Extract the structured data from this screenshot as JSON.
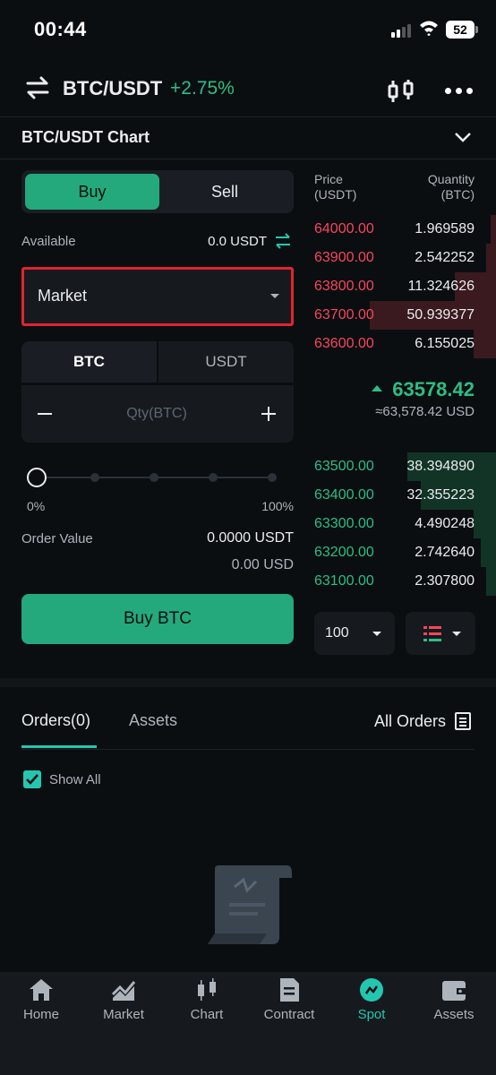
{
  "status_bar": {
    "time": "00:44",
    "battery": "52"
  },
  "header": {
    "pair": "BTC/USDT",
    "change": "+2.75%"
  },
  "chart_bar": {
    "title": "BTC/USDT Chart"
  },
  "trade": {
    "buy_tab": "Buy",
    "sell_tab": "Sell",
    "available_label": "Available",
    "available_value": "0.0 USDT",
    "order_type": "Market",
    "unit_btc": "BTC",
    "unit_usdt": "USDT",
    "qty_placeholder": "Qty(BTC)",
    "slider_min": "0%",
    "slider_max": "100%",
    "slider_value": 0,
    "order_value_label": "Order Value",
    "order_value": "0.0000 USDT",
    "order_value_usd": "0.00 USD",
    "buy_button": "Buy BTC"
  },
  "order_book": {
    "price_header": "Price",
    "price_unit": "(USDT)",
    "qty_header": "Quantity",
    "qty_unit": "(BTC)",
    "asks": [
      {
        "price": "64000.00",
        "qty": "1.969589",
        "depth": 0.03
      },
      {
        "price": "63900.00",
        "qty": "2.542252",
        "depth": 0.05
      },
      {
        "price": "63800.00",
        "qty": "11.324626",
        "depth": 0.22
      },
      {
        "price": "63700.00",
        "qty": "50.939377",
        "depth": 0.67
      },
      {
        "price": "63600.00",
        "qty": "6.155025",
        "depth": 0.12
      }
    ],
    "mid_price": "63578.42",
    "mid_usd": "≈63,578.42 USD",
    "bids": [
      {
        "price": "63500.00",
        "qty": "38.394890",
        "depth": 0.47
      },
      {
        "price": "63400.00",
        "qty": "32.355223",
        "depth": 0.4
      },
      {
        "price": "63300.00",
        "qty": "4.490248",
        "depth": 0.12
      },
      {
        "price": "63200.00",
        "qty": "2.742640",
        "depth": 0.08
      },
      {
        "price": "63100.00",
        "qty": "2.307800",
        "depth": 0.05
      }
    ],
    "depth_value": "100"
  },
  "orders": {
    "tab_orders": "Orders(0)",
    "tab_assets": "Assets",
    "all_orders": "All Orders",
    "show_all": "Show All"
  },
  "nav": [
    {
      "label": "Home",
      "icon": "home-icon"
    },
    {
      "label": "Market",
      "icon": "market-icon"
    },
    {
      "label": "Chart",
      "icon": "chart-icon"
    },
    {
      "label": "Contract",
      "icon": "contract-icon"
    },
    {
      "label": "Spot",
      "icon": "spot-icon"
    },
    {
      "label": "Assets",
      "icon": "wallet-icon"
    }
  ],
  "colors": {
    "accent": "#23c7b0",
    "buy": "#23a97c",
    "up": "#2ebd85",
    "down": "#f6465d"
  }
}
